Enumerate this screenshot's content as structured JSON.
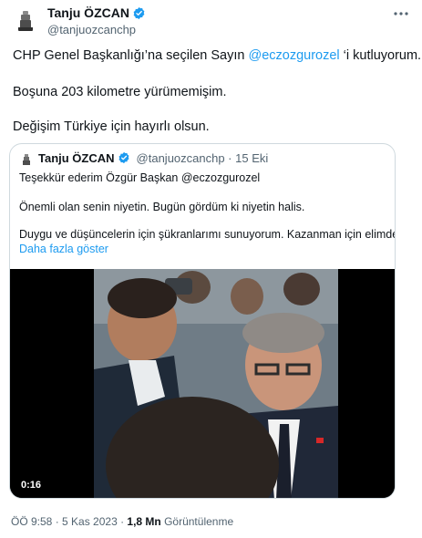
{
  "author": {
    "display_name": "Tanju ÖZCAN",
    "handle": "@tanjuozcanchp"
  },
  "tweet": {
    "line1_prefix": "CHP Genel Başkanlığı’na seçilen Sayın ",
    "line1_mention": "@eczozgurozel",
    "line1_suffix": " ‘i kutluyorum.",
    "line2": "Boşuna 203 kilometre yürümemişim.",
    "line3": "Değişim Türkiye için hayırlı olsun."
  },
  "quote": {
    "display_name": "Tanju ÖZCAN",
    "meta": "@tanjuozcanchp · 15 Eki",
    "line1": "Teşekkür ederim Özgür Başkan @eczozgurozel",
    "line2": "Önemli olan senin niyetin. Bugün gördüm ki niyetin halis.",
    "line3": "Duygu ve düşüncelerin için şükranlarımı sunuyorum. Kazanman için elimden ...",
    "show_more": "Daha fazla göster",
    "video_duration": "0:16"
  },
  "footer": {
    "time_date": "ÖÖ 9:58 · 5 Kas 2023 · ",
    "views_count": "1,8 Mn",
    "views_label": " Görüntülenme"
  },
  "colors": {
    "accent": "#1d9bf0",
    "text_primary": "#0f1419",
    "text_secondary": "#536471",
    "border": "#cfd9de"
  },
  "icons": {
    "verified": "verified-badge-icon",
    "more": "more-options-icon"
  }
}
